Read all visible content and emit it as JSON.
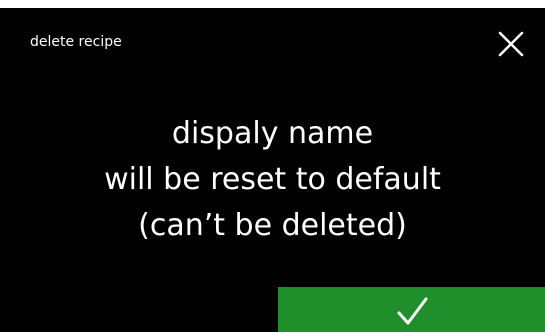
{
  "header": {
    "title": "delete recipe",
    "close_icon": "close-icon"
  },
  "message": {
    "lines": [
      "dispaly name",
      "will be reset to default",
      "(can’t be deleted)"
    ]
  },
  "footer": {
    "confirm_icon": "checkmark-icon"
  },
  "colors": {
    "background": "#000000",
    "text": "#ffffff",
    "confirm_button": "#1f8f2b"
  }
}
